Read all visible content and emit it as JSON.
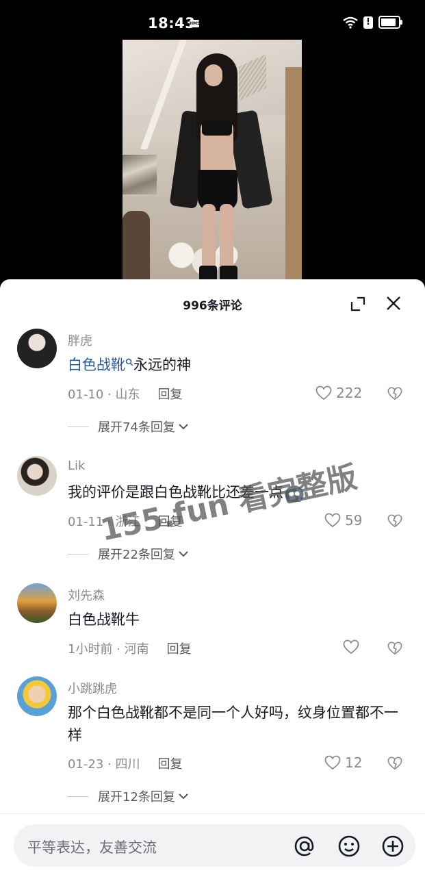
{
  "status_bar": {
    "time": "18:43",
    "hms_label": "HMS"
  },
  "sheet": {
    "title": "996条评论"
  },
  "comments": [
    {
      "user": "胖虎",
      "link_text": "白色战靴",
      "text": "永远的神",
      "date": "01-10",
      "location": "山东",
      "reply_label": "回复",
      "likes": "222",
      "expand_label": "展开74条回复"
    },
    {
      "user": "Lik",
      "text": "我的评价是跟白色战靴比还差一点",
      "date": "01-11",
      "location": "浙江",
      "reply_label": "回复",
      "likes": "59",
      "expand_label": "展开22条回复"
    },
    {
      "user": "刘先森",
      "text": "白色战靴牛",
      "date": "1小时前",
      "location": "河南",
      "reply_label": "回复",
      "likes": ""
    },
    {
      "user": "小跳跳虎",
      "text": "那个白色战靴都不是同一个人好吗，纹身位置都不一样",
      "date": "01-23",
      "location": "四川",
      "reply_label": "回复",
      "likes": "12",
      "expand_label": "展开12条回复"
    }
  ],
  "watermark": "155.fun 看完整版",
  "input": {
    "placeholder": "平等表达，友善交流"
  },
  "icons": [
    "wifi-icon",
    "alert-icon",
    "battery-icon",
    "expand-icon",
    "close-icon",
    "heart-icon",
    "broken-heart-icon",
    "chevron-down-icon",
    "at-icon",
    "emoji-icon",
    "plus-icon"
  ]
}
